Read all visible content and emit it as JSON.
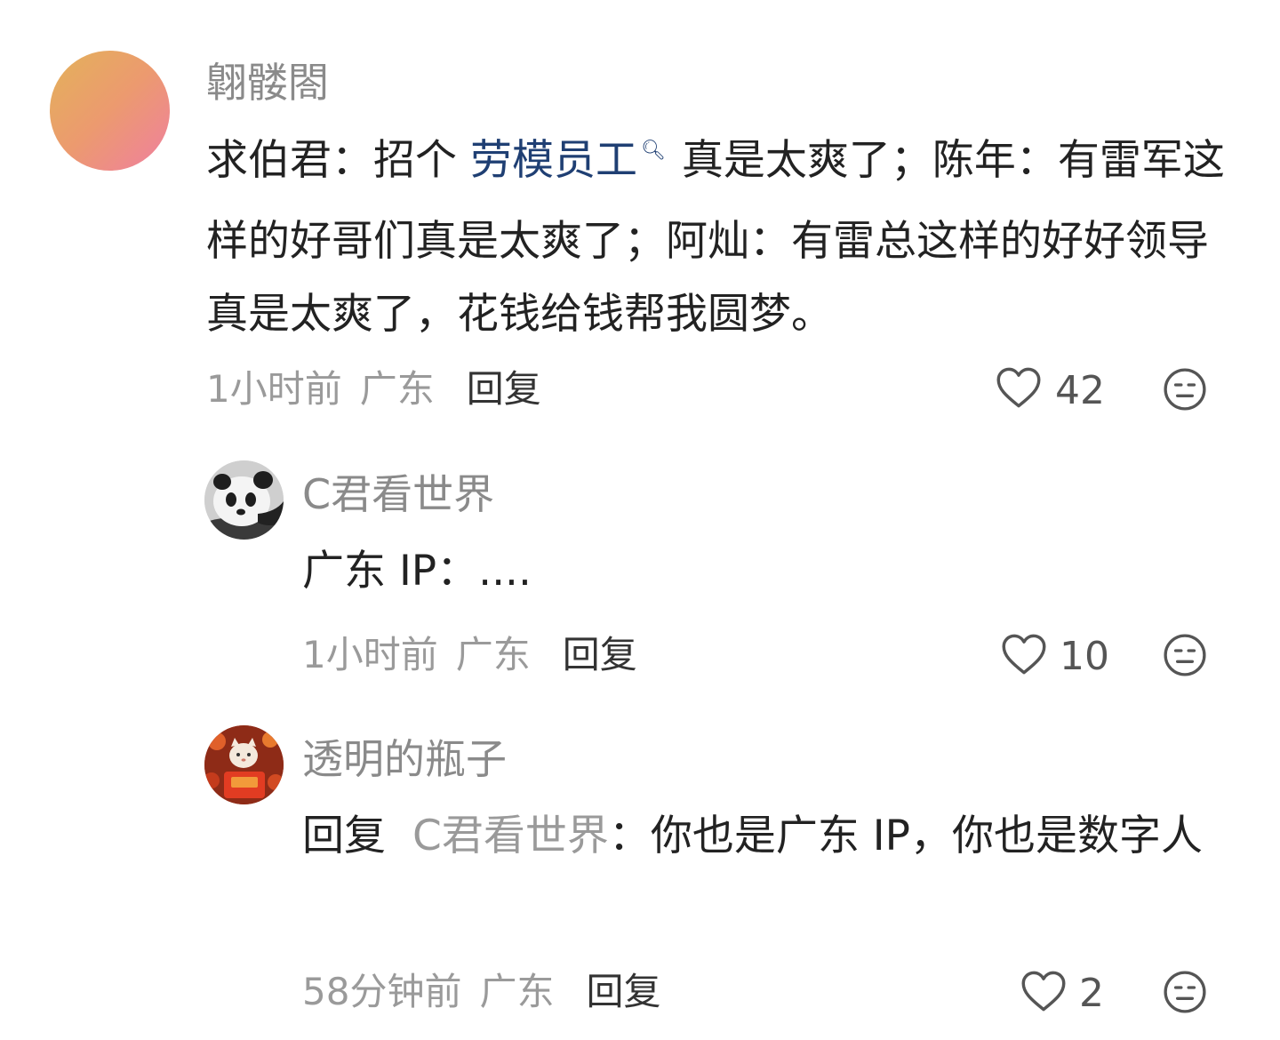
{
  "comments": [
    {
      "author": "翺髅閤",
      "body_pre": "求伯君：招个 ",
      "body_link": "劳模员工",
      "body_post": "真是太爽了；陈年：有雷军这样的好哥们真是太爽了；阿灿：有雷总这样的好好领导真是太爽了，花钱给钱帮我圆梦。",
      "time": "1小时前",
      "location": "广东",
      "reply_label": "回复",
      "likes": "42"
    },
    {
      "author": "C君看世界",
      "body": "广东 IP：....",
      "time": "1小时前",
      "location": "广东",
      "reply_label": "回复",
      "likes": "10"
    },
    {
      "author": "透明的瓶子",
      "reply_prefix": "回复",
      "reply_target": "C君看世界",
      "body": "：你也是广东 IP，你也是数字人",
      "time": "58分钟前",
      "location": "广东",
      "reply_label": "回复",
      "likes": "2"
    }
  ],
  "icons": {
    "like": "heart-outline-icon",
    "emoji": "meh-face-icon",
    "search": "search-icon"
  },
  "colors": {
    "link": "#1f3f73",
    "meta": "#9a9a9a"
  }
}
